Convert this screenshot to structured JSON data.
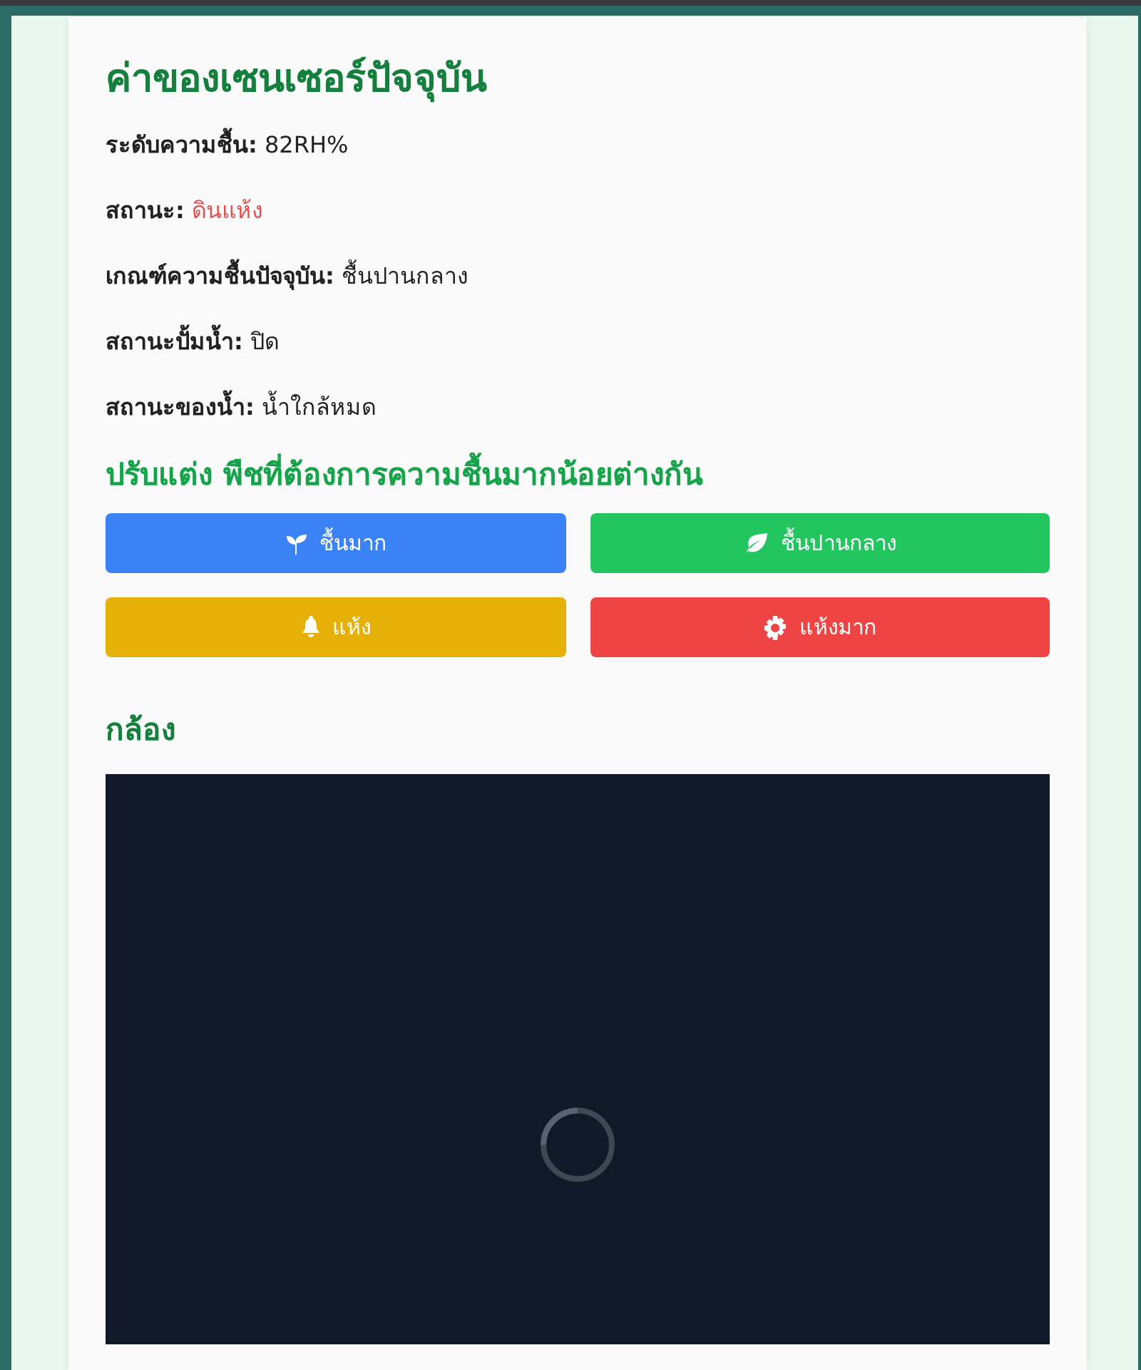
{
  "title": "ค่าของเซนเซอร์ปัจจุบัน",
  "readings": [
    {
      "label": "ระดับความชื้น:",
      "value": "82RH%",
      "alert": false
    },
    {
      "label": "สถานะ:",
      "value": "ดินแห้ง",
      "alert": true
    },
    {
      "label": "เกณฑ์ความชื้นปัจจุบัน:",
      "value": "ชื้นปานกลาง",
      "alert": false
    },
    {
      "label": "สถานะปั้มน้ำ:",
      "value": "ปิด",
      "alert": false
    },
    {
      "label": "สถานะของน้ำ:",
      "value": "น้ำใกล้หมด",
      "alert": false
    }
  ],
  "preset_heading": "ปรับแต่ง พืชที่ต้องการความชื้นมากน้อยต่างกัน",
  "presets": [
    {
      "label": "ชื้นมาก",
      "color": "#3b82f6"
    },
    {
      "label": "ชื้นปานกลาง",
      "color": "#22c55e"
    },
    {
      "label": "แห้ง",
      "color": "#e5b007"
    },
    {
      "label": "แห้งมาก",
      "color": "#ef4444"
    }
  ],
  "camera": {
    "heading": "กล้อง",
    "loading": true
  }
}
